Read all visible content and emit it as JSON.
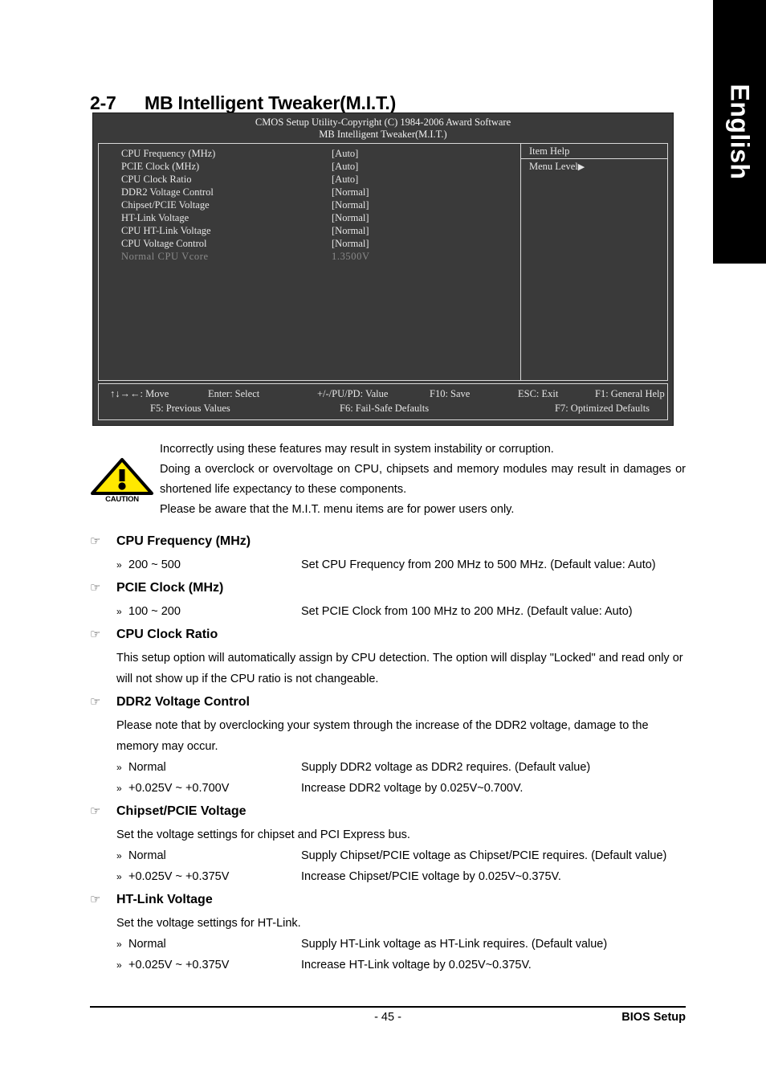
{
  "language_tab": {
    "label": "English"
  },
  "section": {
    "number": "2-7",
    "title": "MB Intelligent Tweaker(M.I.T.)"
  },
  "bios": {
    "title_line1": "CMOS Setup Utility-Copyright (C) 1984-2006 Award Software",
    "title_line2": "MB Intelligent Tweaker(M.I.T.)",
    "items": [
      {
        "name": "CPU Frequency (MHz)",
        "value": "[Auto]"
      },
      {
        "name": "PCIE Clock (MHz)",
        "value": "[Auto]"
      },
      {
        "name": "CPU Clock Ratio",
        "value": "[Auto]"
      },
      {
        "name": "DDR2 Voltage Control",
        "value": "[Normal]"
      },
      {
        "name": "Chipset/PCIE Voltage",
        "value": "[Normal]"
      },
      {
        "name": "HT-Link Voltage",
        "value": "[Normal]"
      },
      {
        "name": "CPU HT-Link Voltage",
        "value": "[Normal]"
      },
      {
        "name": "CPU Voltage Control",
        "value": "[Normal]"
      },
      {
        "name": "Normal CPU Vcore",
        "value": "1.3500V"
      }
    ],
    "help": {
      "title": "Item Help",
      "menu_level": "Menu Level",
      "arrow": "▶"
    },
    "keys_row1": [
      "↑↓→←: Move",
      "Enter: Select",
      "+/-/PU/PD: Value",
      "F10: Save",
      "ESC: Exit",
      "F1: General Help"
    ],
    "keys_row2": [
      "F5: Previous Values",
      "F6: Fail-Safe Defaults",
      "F7: Optimized Defaults"
    ]
  },
  "caution": {
    "icon_caption": "CAUTION",
    "line1": "Incorrectly using these features may result in system instability or corruption.",
    "line2": "Doing a overclock or overvoltage on CPU, chipsets and memory modules may result in damages or shortened life expectancy to these components.",
    "line3": "Please be aware that the M.I.T. menu items are for power users only."
  },
  "icons": {
    "hand": "☞",
    "double_arrow": "»"
  },
  "options": [
    {
      "title": "CPU Frequency (MHz)",
      "body": "",
      "items": [
        {
          "value": "200 ~ 500",
          "desc": "Set CPU Frequency from 200 MHz to 500 MHz. (Default value: Auto)"
        }
      ]
    },
    {
      "title": "PCIE Clock (MHz)",
      "body": "",
      "items": [
        {
          "value": "100 ~ 200",
          "desc": "Set PCIE Clock from 100 MHz to 200 MHz. (Default value: Auto)"
        }
      ]
    },
    {
      "title": "CPU Clock Ratio",
      "body": "This setup option will automatically assign by CPU detection. The option will display \"Locked\" and read only or will not show up if the CPU ratio is not changeable.",
      "items": []
    },
    {
      "title": "DDR2 Voltage Control",
      "body": "Please note that by overclocking your system through the increase of the DDR2 voltage, damage to the memory may occur.",
      "items": [
        {
          "value": "Normal",
          "desc": "Supply DDR2 voltage as DDR2 requires. (Default value)"
        },
        {
          "value": "+0.025V ~ +0.700V",
          "desc": "Increase DDR2 voltage by 0.025V~0.700V."
        }
      ]
    },
    {
      "title": "Chipset/PCIE Voltage",
      "body": "Set the voltage settings for chipset and PCI Express bus.",
      "items": [
        {
          "value": "Normal",
          "desc": "Supply Chipset/PCIE voltage as Chipset/PCIE requires. (Default value)"
        },
        {
          "value": "+0.025V ~ +0.375V",
          "desc": "Increase Chipset/PCIE voltage by 0.025V~0.375V."
        }
      ]
    },
    {
      "title": "HT-Link Voltage",
      "body": "Set the voltage settings for HT-Link.",
      "items": [
        {
          "value": "Normal",
          "desc": "Supply HT-Link voltage as HT-Link requires. (Default value)"
        },
        {
          "value": "+0.025V ~ +0.375V",
          "desc": "Increase HT-Link voltage by 0.025V~0.375V."
        }
      ]
    }
  ],
  "footer": {
    "page_number": "- 45 -",
    "doc_name": "BIOS Setup"
  },
  "colors": {
    "caution_yellow": "#FFE800",
    "bios_bg": "#3a3a3a",
    "tab_bg": "#000000"
  }
}
